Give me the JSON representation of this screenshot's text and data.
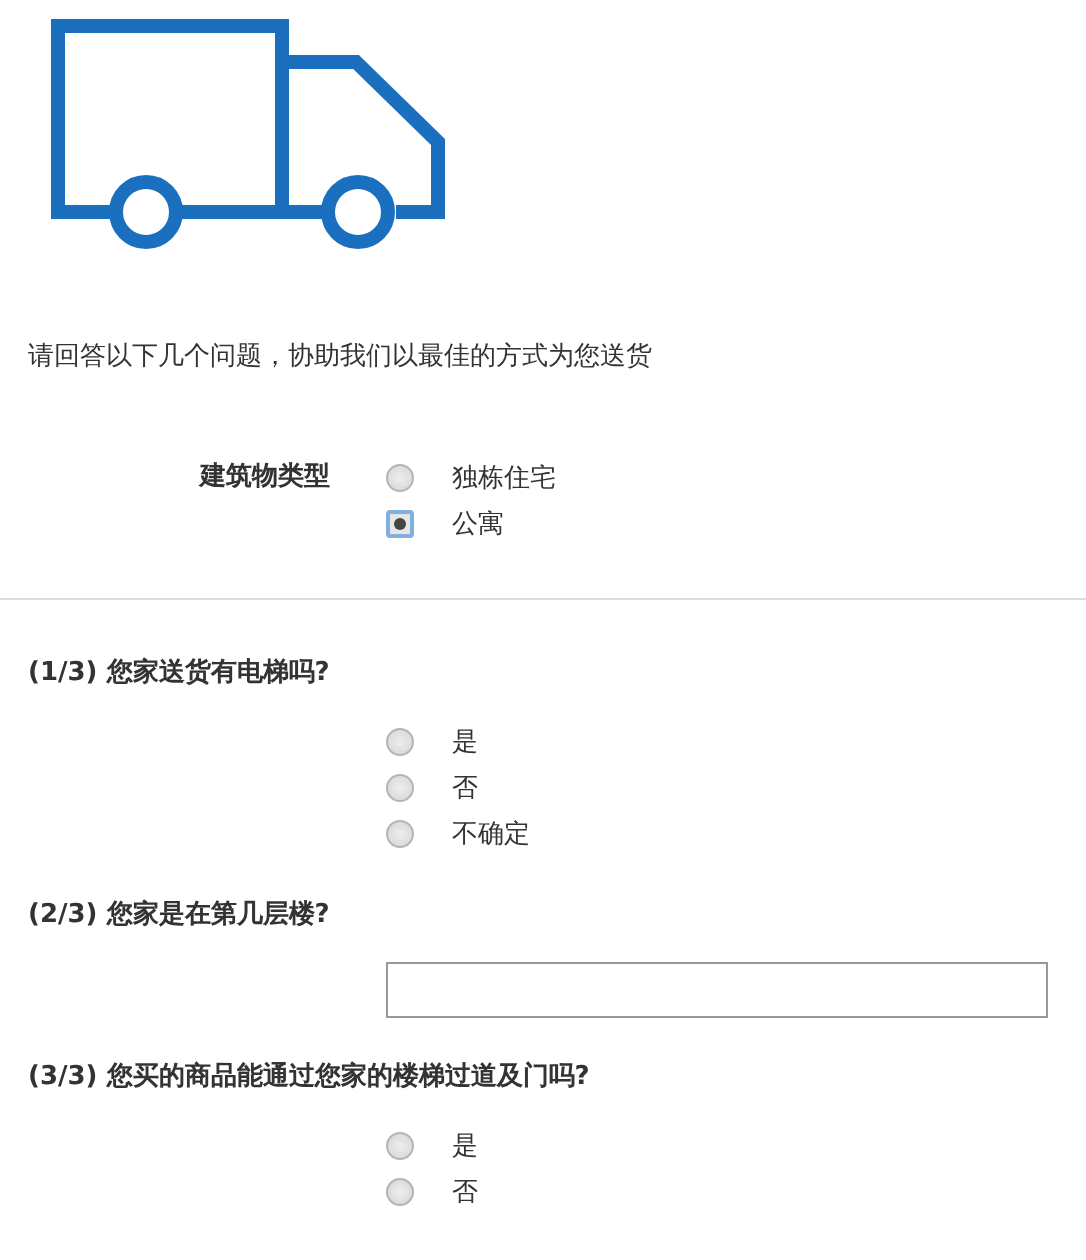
{
  "intro": "请回答以下几个问题，协助我们以最佳的方式为您送货",
  "building_type": {
    "label": "建筑物类型",
    "options": [
      {
        "label": "独栋住宅",
        "selected": false
      },
      {
        "label": "公寓",
        "selected": true
      }
    ]
  },
  "questions": [
    {
      "kind": "choice",
      "number": "(1/3)",
      "text": "您家送货有电梯吗?",
      "options": [
        {
          "label": "是",
          "selected": false
        },
        {
          "label": "否",
          "selected": false
        },
        {
          "label": "不确定",
          "selected": false
        }
      ]
    },
    {
      "kind": "text",
      "number": "(2/3)",
      "text": "您家是在第几层楼?"
    },
    {
      "kind": "choice",
      "number": "(3/3)",
      "text": "您买的商品能通过您家的楼梯过道及门吗?",
      "options": [
        {
          "label": "是",
          "selected": false
        },
        {
          "label": "否",
          "selected": false
        }
      ]
    }
  ]
}
